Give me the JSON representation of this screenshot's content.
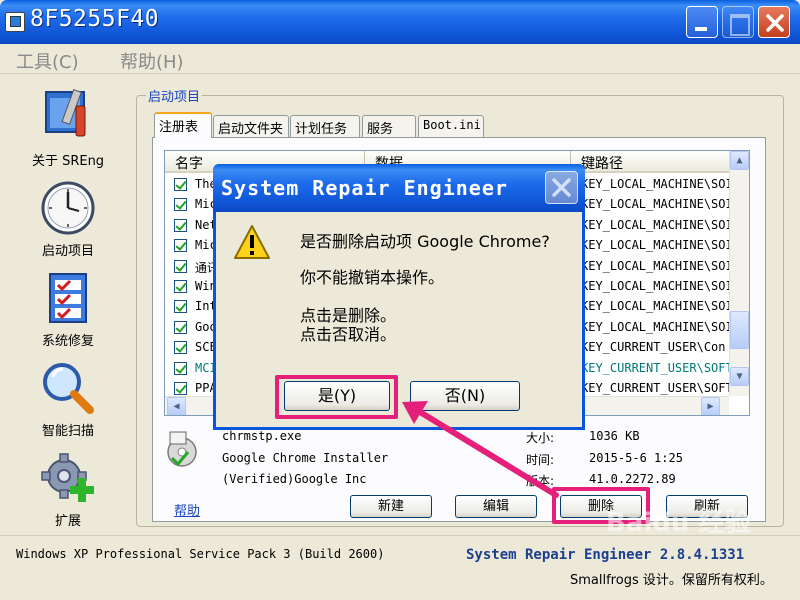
{
  "window": {
    "title": "8F5255F40",
    "controls": {
      "minimize": "minimize",
      "maximize": "maximize",
      "close": "close"
    }
  },
  "menu": {
    "tools": "工具(C)",
    "help": "帮助(H)"
  },
  "sidebar": {
    "items": [
      {
        "label": "关于 SREng",
        "icon": "toolbox-icon"
      },
      {
        "label": "启动项目",
        "icon": "clock-icon"
      },
      {
        "label": "系统修复",
        "icon": "checklist-icon"
      },
      {
        "label": "智能扫描",
        "icon": "magnifier-icon"
      },
      {
        "label": "扩展",
        "icon": "gear-plus-icon"
      }
    ]
  },
  "group": {
    "title": "启动项目"
  },
  "tabs": [
    "注册表",
    "启动文件夹",
    "计划任务",
    "服务",
    "Boot.ini"
  ],
  "list": {
    "columns": [
      "名字",
      "数据",
      "键路径"
    ],
    "rows": [
      {
        "name": "The",
        "path": "KEY_LOCAL_MACHINE\\SOI",
        "checked": true,
        "hive": "hklm"
      },
      {
        "name": "Mic",
        "path": "KEY_LOCAL_MACHINE\\SOI",
        "checked": true,
        "hive": "hklm"
      },
      {
        "name": "Net",
        "path": "KEY_LOCAL_MACHINE\\SOI",
        "checked": true,
        "hive": "hklm"
      },
      {
        "name": "Mic",
        "path": "KEY_LOCAL_MACHINE\\SOI",
        "checked": true,
        "hive": "hklm"
      },
      {
        "name": "通讯",
        "path": "KEY_LOCAL_MACHINE\\SOI",
        "checked": true,
        "hive": "hklm"
      },
      {
        "name": "Win",
        "path": "KEY_LOCAL_MACHINE\\SOI",
        "checked": true,
        "hive": "hklm"
      },
      {
        "name": "Int",
        "path": "KEY_LOCAL_MACHINE\\SOI",
        "checked": true,
        "hive": "hklm"
      },
      {
        "name": "Goo",
        "path": "KEY_LOCAL_MACHINE\\SOI",
        "checked": true,
        "hive": "hklm"
      },
      {
        "name": "SCE",
        "path": "KEY_CURRENT_USER\\Con",
        "checked": true,
        "hive": "hkcu"
      },
      {
        "name": "MCI",
        "path": "KEY_CURRENT_USER\\SOFT",
        "checked": true,
        "hive": "hkcu"
      },
      {
        "name": "PPA",
        "path": "KEY_CURRENT_USER\\SOFT",
        "checked": true,
        "hive": "hklm"
      }
    ]
  },
  "details": {
    "file": "chrmstp.exe",
    "description": "Google Chrome Installer",
    "company": "(Verified)Google Inc",
    "size_label": "大小:",
    "size": "1036 KB",
    "time_label": "时间:",
    "time": "2015-5-6 1:25",
    "version_label": "版本:",
    "version": "41.0.2272.89"
  },
  "footer": {
    "help_link": "帮助",
    "new": "新建",
    "edit": "编辑",
    "delete": "删除",
    "refresh": "刷新"
  },
  "status": {
    "os": "Windows XP Professional Service Pack 3 (Build 2600)",
    "product": "System Repair Engineer 2.8.4.1331",
    "copyright": "Smallfrogs 设计。保留所有权利。"
  },
  "dialog": {
    "title": "System Repair Engineer",
    "line1": "是否删除启动项 Google Chrome?",
    "line2": "你不能撤销本操作。",
    "line3": "点击是删除。",
    "line4": "点击否取消。",
    "yes": "是(Y)",
    "no": "否(N)"
  },
  "colors": {
    "highlight": "#E5207A",
    "titlebar": "#0F55D6",
    "face": "#ECE9D8"
  },
  "watermark": "Baidu 经验"
}
